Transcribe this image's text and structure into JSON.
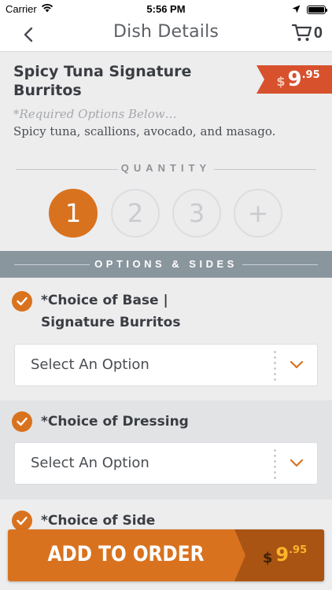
{
  "status_bar": {
    "carrier": "Carrier",
    "time": "5:56 PM"
  },
  "nav": {
    "title": "Dish Details",
    "cart_count": "0"
  },
  "dish": {
    "name": "Spicy Tuna Signature Burritos",
    "price": {
      "currency": "$",
      "whole": "9",
      "cents": ".95"
    },
    "required_note": "*Required Options Below…",
    "description": "Spicy tuna, scallions, avocado, and masago."
  },
  "quantity": {
    "label": "QUANTITY",
    "options": [
      "1",
      "2",
      "3",
      "+"
    ],
    "selected": "1"
  },
  "options_section": {
    "label": "OPTIONS & SIDES"
  },
  "option_groups": [
    {
      "title_line1": "*Choice of Base |",
      "title_line2": "Signature Burritos",
      "select_placeholder": "Select An Option"
    },
    {
      "title_line1": "*Choice of Dressing",
      "select_placeholder": "Select An Option"
    },
    {
      "title_line1": "*Choice of Side"
    }
  ],
  "add_to_order": {
    "label": "ADD TO ORDER",
    "price": {
      "currency": "$",
      "whole": "9",
      "cents": ".95"
    }
  },
  "colors": {
    "accent_orange": "#d9721f",
    "price_red": "#d8512d",
    "options_bar": "#8a969e",
    "price_panel": "#a95413",
    "price_text": "#ffb32b"
  }
}
